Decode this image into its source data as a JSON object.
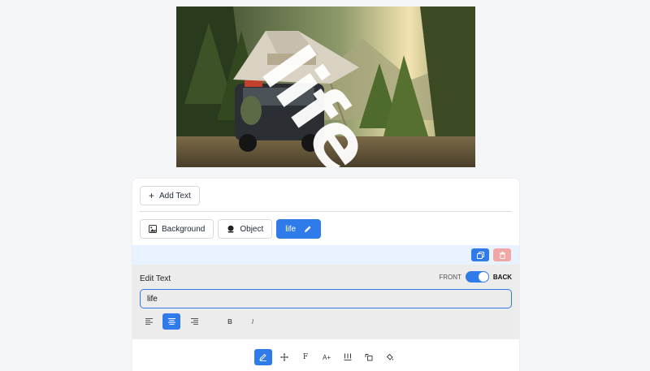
{
  "canvas": {
    "overlay_text": "life"
  },
  "toolbar": {
    "add_text_label": "Add Text"
  },
  "tabs": [
    {
      "label": "Background",
      "icon": "image-icon"
    },
    {
      "label": "Object",
      "icon": "shape-icon"
    },
    {
      "label": "life",
      "icon": "pencil-icon",
      "active": true
    }
  ],
  "editor": {
    "title": "Edit Text",
    "front_label": "FRONT",
    "back_label": "BACK",
    "text_value": "life",
    "bold_label": "B",
    "italic_label": "I",
    "font_label": "F",
    "size_label": "A+"
  },
  "colors": {
    "accent": "#2f7bea",
    "danger": "#f2a7a7",
    "highlight_strip": "#e9f3ff"
  }
}
